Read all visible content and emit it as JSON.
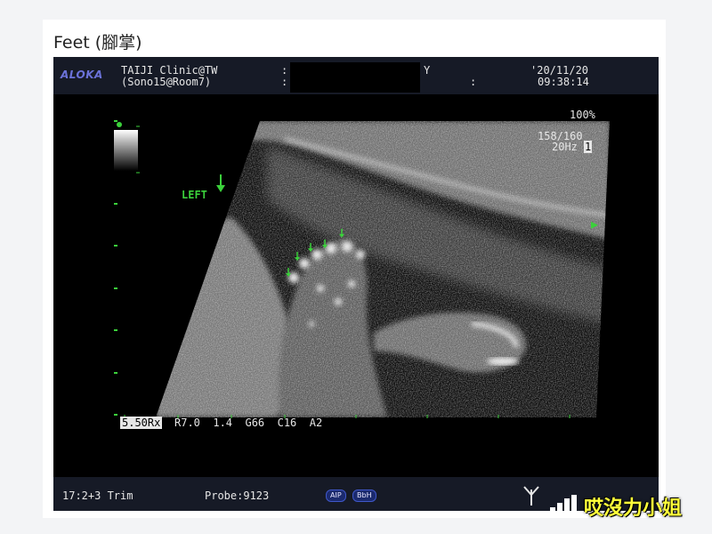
{
  "page": {
    "title": "Feet (腳掌)"
  },
  "scan": {
    "brand": "ALOKA",
    "clinic_line1": "TAIJI Clinic@TW",
    "clinic_line2": "(Sono15@Room7)",
    "sep1": ":",
    "sep2": ":",
    "age_unit": "Y",
    "sep3": ":",
    "date": "'20/11/20",
    "time": "09:38:14",
    "gain_pct": "100%",
    "depth": "158/160",
    "frame_rate": "20Hz",
    "frame_box": "1",
    "orientation_label": "LEFT",
    "settings_box": "5.50Rx",
    "settings": "R7.0  1.4  G66  C16  A2",
    "footer_left": "17:2+3 Trim",
    "probe": "Probe:9123",
    "pills": [
      "AIP",
      "BbH"
    ]
  },
  "watermark": {
    "text": "哎沒力小姐"
  },
  "colors": {
    "marker": "#3bd13b",
    "logo": "#6b72d8",
    "header_bg": "#161a26",
    "watermark": "#ffff3a"
  }
}
